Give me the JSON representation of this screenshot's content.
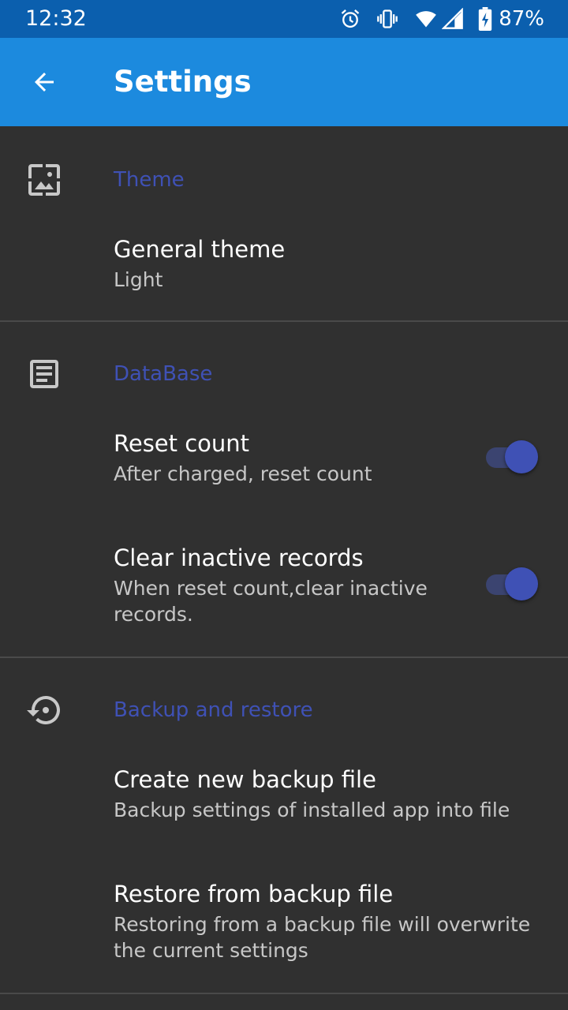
{
  "status": {
    "time": "12:32",
    "battery": "87%",
    "icons": [
      "alarm-icon",
      "vibrate-icon",
      "wifi-icon",
      "signal-icon",
      "battery-charging-icon"
    ]
  },
  "app_bar": {
    "title": "Settings",
    "back_icon": "arrow-back-icon"
  },
  "categories": {
    "theme": {
      "title": "Theme",
      "icon": "wallpaper-icon",
      "items": {
        "general_theme": {
          "title": "General theme",
          "summary": "Light"
        }
      }
    },
    "database": {
      "title": "DataBase",
      "icon": "storage-icon",
      "items": {
        "reset_count": {
          "title": "Reset count",
          "summary": "After charged, reset count",
          "checked": true
        },
        "clear_inactive": {
          "title": "Clear inactive records",
          "summary": "When reset count,clear inactive records.",
          "checked": true
        }
      }
    },
    "backup": {
      "title": "Backup and restore",
      "icon": "restore-icon",
      "items": {
        "create_backup": {
          "title": "Create new backup file",
          "summary": "Backup settings of installed app into file"
        },
        "restore_backup": {
          "title": "Restore from backup file",
          "summary": "Restoring from a backup file will overwrite the current settings"
        }
      }
    }
  },
  "colors": {
    "status_bar": "#0b5fae",
    "app_bar": "#1c8ade",
    "background": "#303030",
    "accent": "#3f51b5"
  }
}
